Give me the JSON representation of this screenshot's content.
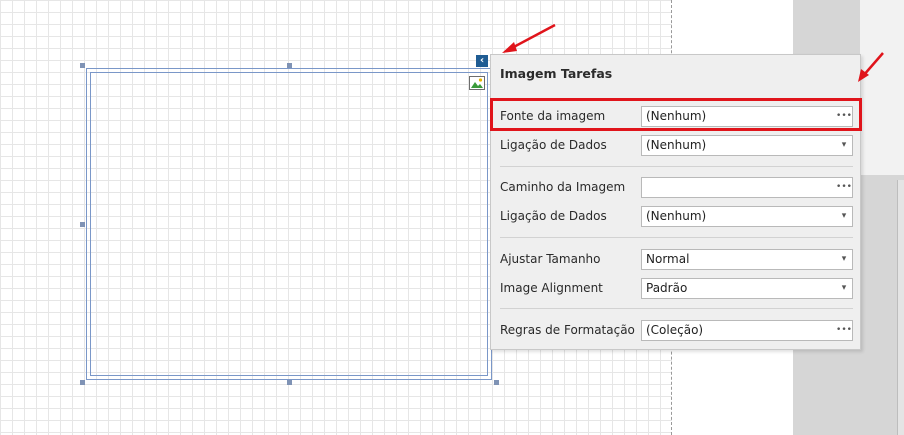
{
  "panel": {
    "title": "Imagem Tarefas",
    "rows": [
      {
        "label": "Fonte da imagem",
        "value": "(Nenhum)",
        "button": "ellipsis-icon"
      },
      {
        "label": "Ligação de Dados",
        "value": "(Nenhum)",
        "button": "chevron-down-icon"
      },
      {
        "label": "Caminho da Imagem",
        "value": "",
        "button": "ellipsis-icon"
      },
      {
        "label": "Ligação de Dados",
        "value": "(Nenhum)",
        "button": "chevron-down-icon"
      },
      {
        "label": "Ajustar Tamanho",
        "value": "Normal",
        "button": "chevron-down-icon"
      },
      {
        "label": "Image Alignment",
        "value": "Padrão",
        "button": "chevron-down-icon"
      },
      {
        "label": "Regras de Formatação",
        "value": "(Coleção)",
        "button": "ellipsis-icon"
      }
    ]
  },
  "colors": {
    "highlight": "#e0141b",
    "smart_tag": "#1f5c93",
    "selection": "#7a97c8"
  }
}
